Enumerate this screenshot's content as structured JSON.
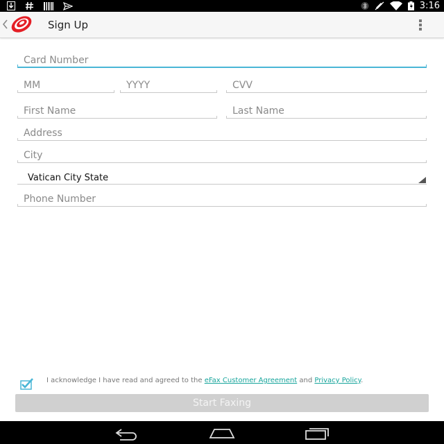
{
  "status_bar": {
    "time": "3:16",
    "left_icons": [
      "download-icon",
      "hashtag-icon",
      "barcode-icon",
      "send-icon"
    ],
    "right_icons": [
      "bluetooth-icon",
      "mute-icon",
      "wifi-icon",
      "battery-icon"
    ]
  },
  "action_bar": {
    "title": "Sign Up",
    "logo": "efax-logo-icon"
  },
  "form": {
    "card_number_placeholder": "Card Number",
    "month_placeholder": "MM",
    "year_placeholder": "YYYY",
    "cvv_placeholder": "CVV",
    "first_name_placeholder": "First Name",
    "last_name_placeholder": "Last Name",
    "address_placeholder": "Address",
    "city_placeholder": "City",
    "country_selected": "Vatican City State",
    "phone_placeholder": "Phone Number"
  },
  "agreement": {
    "checked": true,
    "text_prefix": "I acknowledge I have read and agreed to the ",
    "link1": "eFax Customer Agreement",
    "text_middle": " and ",
    "link2": "Privacy Policy",
    "text_suffix": "."
  },
  "start_button_label": "Start Faxing",
  "colors": {
    "accent": "#49b6d6",
    "link": "#17a59c",
    "logo_red": "#e41f26",
    "button_disabled": "#d0d0d0"
  }
}
